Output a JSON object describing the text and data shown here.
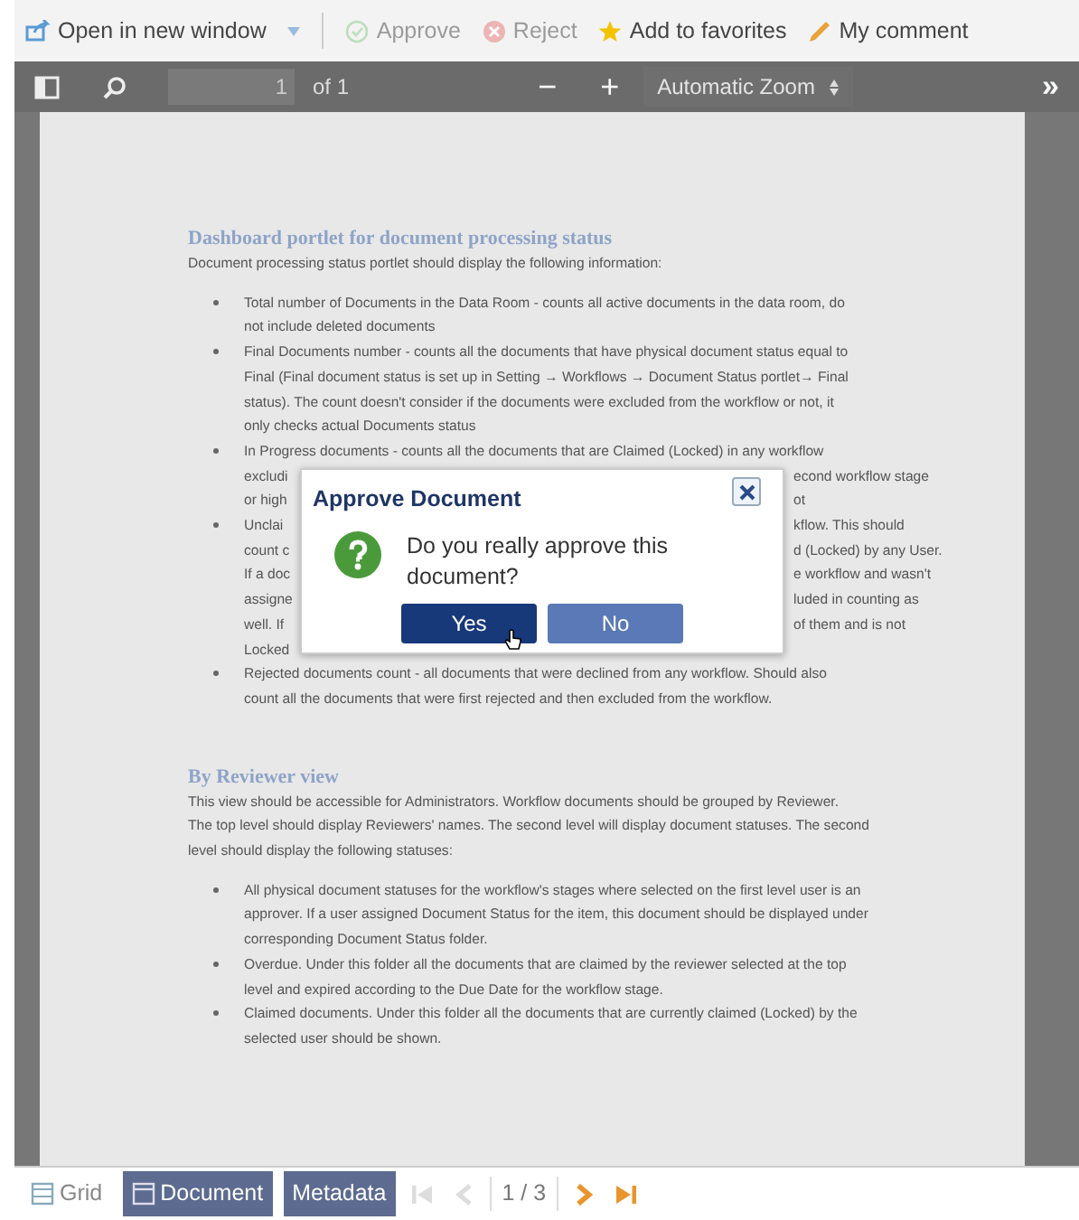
{
  "toolbar": {
    "items": [
      {
        "kind": "open",
        "label": "Open in new window",
        "disabled": false
      },
      {
        "kind": "approve",
        "label": "Approve",
        "disabled": true
      },
      {
        "kind": "reject",
        "label": "Reject",
        "disabled": true
      },
      {
        "kind": "favorite",
        "label": "Add to favorites",
        "disabled": false
      },
      {
        "kind": "comment",
        "label": "My comment",
        "disabled": false
      }
    ]
  },
  "viewer_toolbar": {
    "page_value": "1",
    "page_count": "of 1",
    "zoom_out": "−",
    "zoom_in": "+",
    "zoom": "Automatic Zoom",
    "more": "»"
  },
  "document": {
    "sections": [
      {
        "heading": "Dashboard portlet for document processing status",
        "intro": [
          "Document processing status portlet should display the following information:"
        ],
        "bullets": [
          {
            "lines": [
              {
                "text": "Total number of Documents in the Data Room - counts all active documents in the data room, do"
              },
              {
                "text": "not include deleted documents"
              }
            ]
          },
          {
            "lines": [
              {
                "text": "Final Documents number - counts all the documents that have physical document status equal to"
              },
              {
                "text": "Final (Final document status is set up in Setting → Workflows → Document Status portlet→ Final"
              },
              {
                "text": "status). The count doesn't consider if the documents were excluded from the workflow or not, it"
              },
              {
                "text": "only checks actual Documents status"
              }
            ]
          },
          {
            "lines": [
              {
                "text": "In Progress documents - counts all the documents that are Claimed (Locked) in any workflow"
              },
              {
                "left": "excludi",
                "right": "econd workflow stage"
              },
              {
                "left": "or high",
                "right": "ot"
              }
            ]
          },
          {
            "lines": [
              {
                "left": "Unclai",
                "right": "kflow. This should"
              },
              {
                "left": "count c",
                "right": "d (Locked) by any User."
              },
              {
                "left": "If a doc",
                "right": "e workflow and wasn't"
              },
              {
                "left": "assigne",
                "right": "luded in counting as"
              },
              {
                "left": "well. If",
                "right": "of them and is not"
              },
              {
                "left": "Locked"
              }
            ]
          },
          {
            "lines": [
              {
                "text": "Rejected documents count - all documents that were declined from any workflow. Should also"
              },
              {
                "text": "count all the documents that were first rejected and then excluded from the workflow."
              }
            ]
          }
        ]
      },
      {
        "heading": "By Reviewer view",
        "intro": [
          "This view should be accessible for Administrators. Workflow documents should be grouped by Reviewer.",
          "The top level should display Reviewers' names. The second level will display document statuses. The second",
          "level should display the following statuses:"
        ],
        "bullets": [
          {
            "lines": [
              {
                "text": "All physical document statuses for the workflow's stages where selected on the first level user is an"
              },
              {
                "text": "approver. If a user assigned Document Status for the item, this document should be displayed under"
              },
              {
                "text": "corresponding Document Status folder."
              }
            ]
          },
          {
            "lines": [
              {
                "text": "Overdue. Under this folder all the documents that are claimed by the reviewer selected at the top"
              },
              {
                "text": "level and expired according to the Due Date for the workflow stage."
              }
            ]
          },
          {
            "lines": [
              {
                "text": "Claimed documents. Under this folder all the documents that are currently claimed (Locked) by the"
              },
              {
                "text": "selected user should be shown."
              }
            ]
          }
        ]
      }
    ]
  },
  "dialog": {
    "title": "Approve Document",
    "message": "Do you really approve this document?",
    "buttons": [
      {
        "label": "Yes",
        "hovered": true
      },
      {
        "label": "No",
        "hovered": false
      }
    ]
  },
  "bottom_bar": {
    "tabs": [
      {
        "label": "Grid",
        "kind": "grid",
        "selected": false
      },
      {
        "label": "Document",
        "kind": "document",
        "selected": true
      },
      {
        "label": "Metadata",
        "kind": "metadata",
        "selected": true
      }
    ],
    "pager": [
      {
        "kind": "first",
        "disabled": true
      },
      {
        "kind": "prev",
        "disabled": true
      },
      {
        "kind": "text",
        "label": "1 / 3"
      },
      {
        "kind": "next",
        "disabled": false
      },
      {
        "kind": "last",
        "disabled": false
      }
    ]
  }
}
